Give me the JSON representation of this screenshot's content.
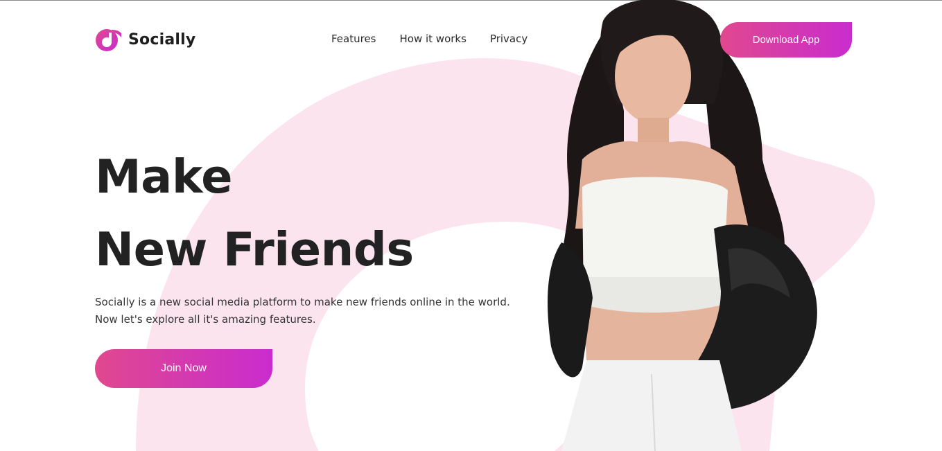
{
  "brand": {
    "name": "Socially",
    "logo_icon": "socially-logo-mark",
    "accent_start": "#e0488f",
    "accent_end": "#c92cce",
    "bg_shape_color": "#fce4ef"
  },
  "nav": {
    "items": [
      {
        "label": "Features"
      },
      {
        "label": "How it works"
      },
      {
        "label": "Privacy"
      }
    ]
  },
  "header": {
    "download_label": "Download App"
  },
  "hero": {
    "title_line1": "Make",
    "title_line2": "New Friends",
    "description": "Socially is a new social media platform to make new friends online in the world. Now let's explore all it's amazing features.",
    "cta_label": "Join Now",
    "image": "woman-portrait-photo"
  }
}
